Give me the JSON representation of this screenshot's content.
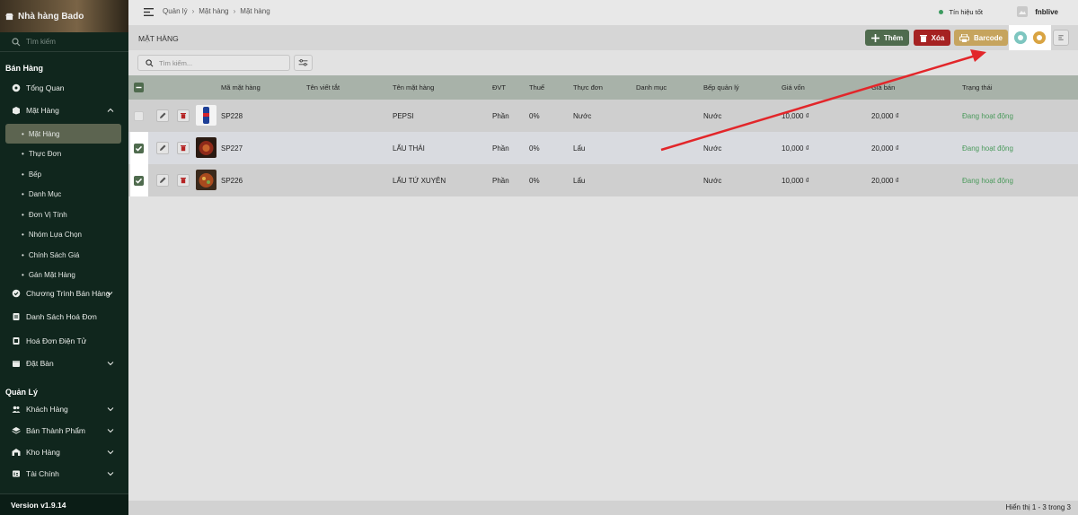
{
  "sidebar": {
    "brand": "Nhà hàng Bado",
    "search_placeholder": "Tìm kiếm",
    "section_sales": "Bán Hàng",
    "section_manage": "Quản Lý",
    "items": {
      "overview": "Tổng Quan",
      "products": "Mặt Hàng",
      "sub_products": "Mặt Hàng",
      "sub_menu": "Thực Đơn",
      "sub_kitchen": "Bếp",
      "sub_category": "Danh Mục",
      "sub_unit": "Đơn Vị Tính",
      "sub_option_group": "Nhóm Lựa Chọn",
      "sub_price_policy": "Chính Sách Giá",
      "sub_assign": "Gán Mặt Hàng",
      "sales_program": "Chương Trình Bán Hàng",
      "invoice_list": "Danh Sách Hoá Đơn",
      "e_invoice": "Hoá Đơn Điện Tử",
      "booking": "Đặt Bàn",
      "customers": "Khách Hàng",
      "semi_products": "Bán Thành Phẩm",
      "warehouse": "Kho Hàng",
      "finance": "Tài Chính"
    },
    "version": "Version v1.9.14"
  },
  "topbar": {
    "breadcrumb": [
      "Quản lý",
      "Mặt hàng",
      "Mặt hàng"
    ],
    "signal": "Tín hiệu tốt",
    "user": "fnblive"
  },
  "header": {
    "title": "MẶT HÀNG",
    "add_label": "Thêm",
    "delete_label": "Xóa",
    "barcode_label": "Barcode"
  },
  "search": {
    "placeholder": "Tìm kiếm..."
  },
  "table": {
    "columns": [
      "Mã mặt hàng",
      "Tên viết tắt",
      "Tên mặt hàng",
      "ĐVT",
      "Thuế",
      "Thực đơn",
      "Danh mục",
      "Bếp quản lý",
      "Giá vốn",
      "Giá bán",
      "Trạng thái"
    ],
    "rows": [
      {
        "code": "SP228",
        "short": "",
        "name": "PEPSI",
        "unit": "Phần",
        "tax": "0%",
        "menu": "Nước",
        "category": "",
        "kitchen": "Nước",
        "cost": "10,000 ₫",
        "price": "20,000 ₫",
        "status": "Đang hoạt động",
        "checked": false
      },
      {
        "code": "SP227",
        "short": "",
        "name": "LẨU THÁI",
        "unit": "Phần",
        "tax": "0%",
        "menu": "Lẩu",
        "category": "",
        "kitchen": "Nước",
        "cost": "10,000 ₫",
        "price": "20,000 ₫",
        "status": "Đang hoạt động",
        "checked": true
      },
      {
        "code": "SP226",
        "short": "",
        "name": "LẨU TỨ XUYÊN",
        "unit": "Phần",
        "tax": "0%",
        "menu": "Lẩu",
        "category": "",
        "kitchen": "Nước",
        "cost": "10,000 ₫",
        "price": "20,000 ₫",
        "status": "Đang hoạt động",
        "checked": true
      }
    ]
  },
  "footer": {
    "pagination": "Hiển thị 1 - 3 trong 3"
  },
  "colors": {
    "sidebar_bg": "#10261d",
    "accent_green": "#4f6b4e",
    "danger": "#a52222",
    "barcode": "#c6a45e",
    "status": "#4b9a5c",
    "arrow": "#e2262a"
  }
}
